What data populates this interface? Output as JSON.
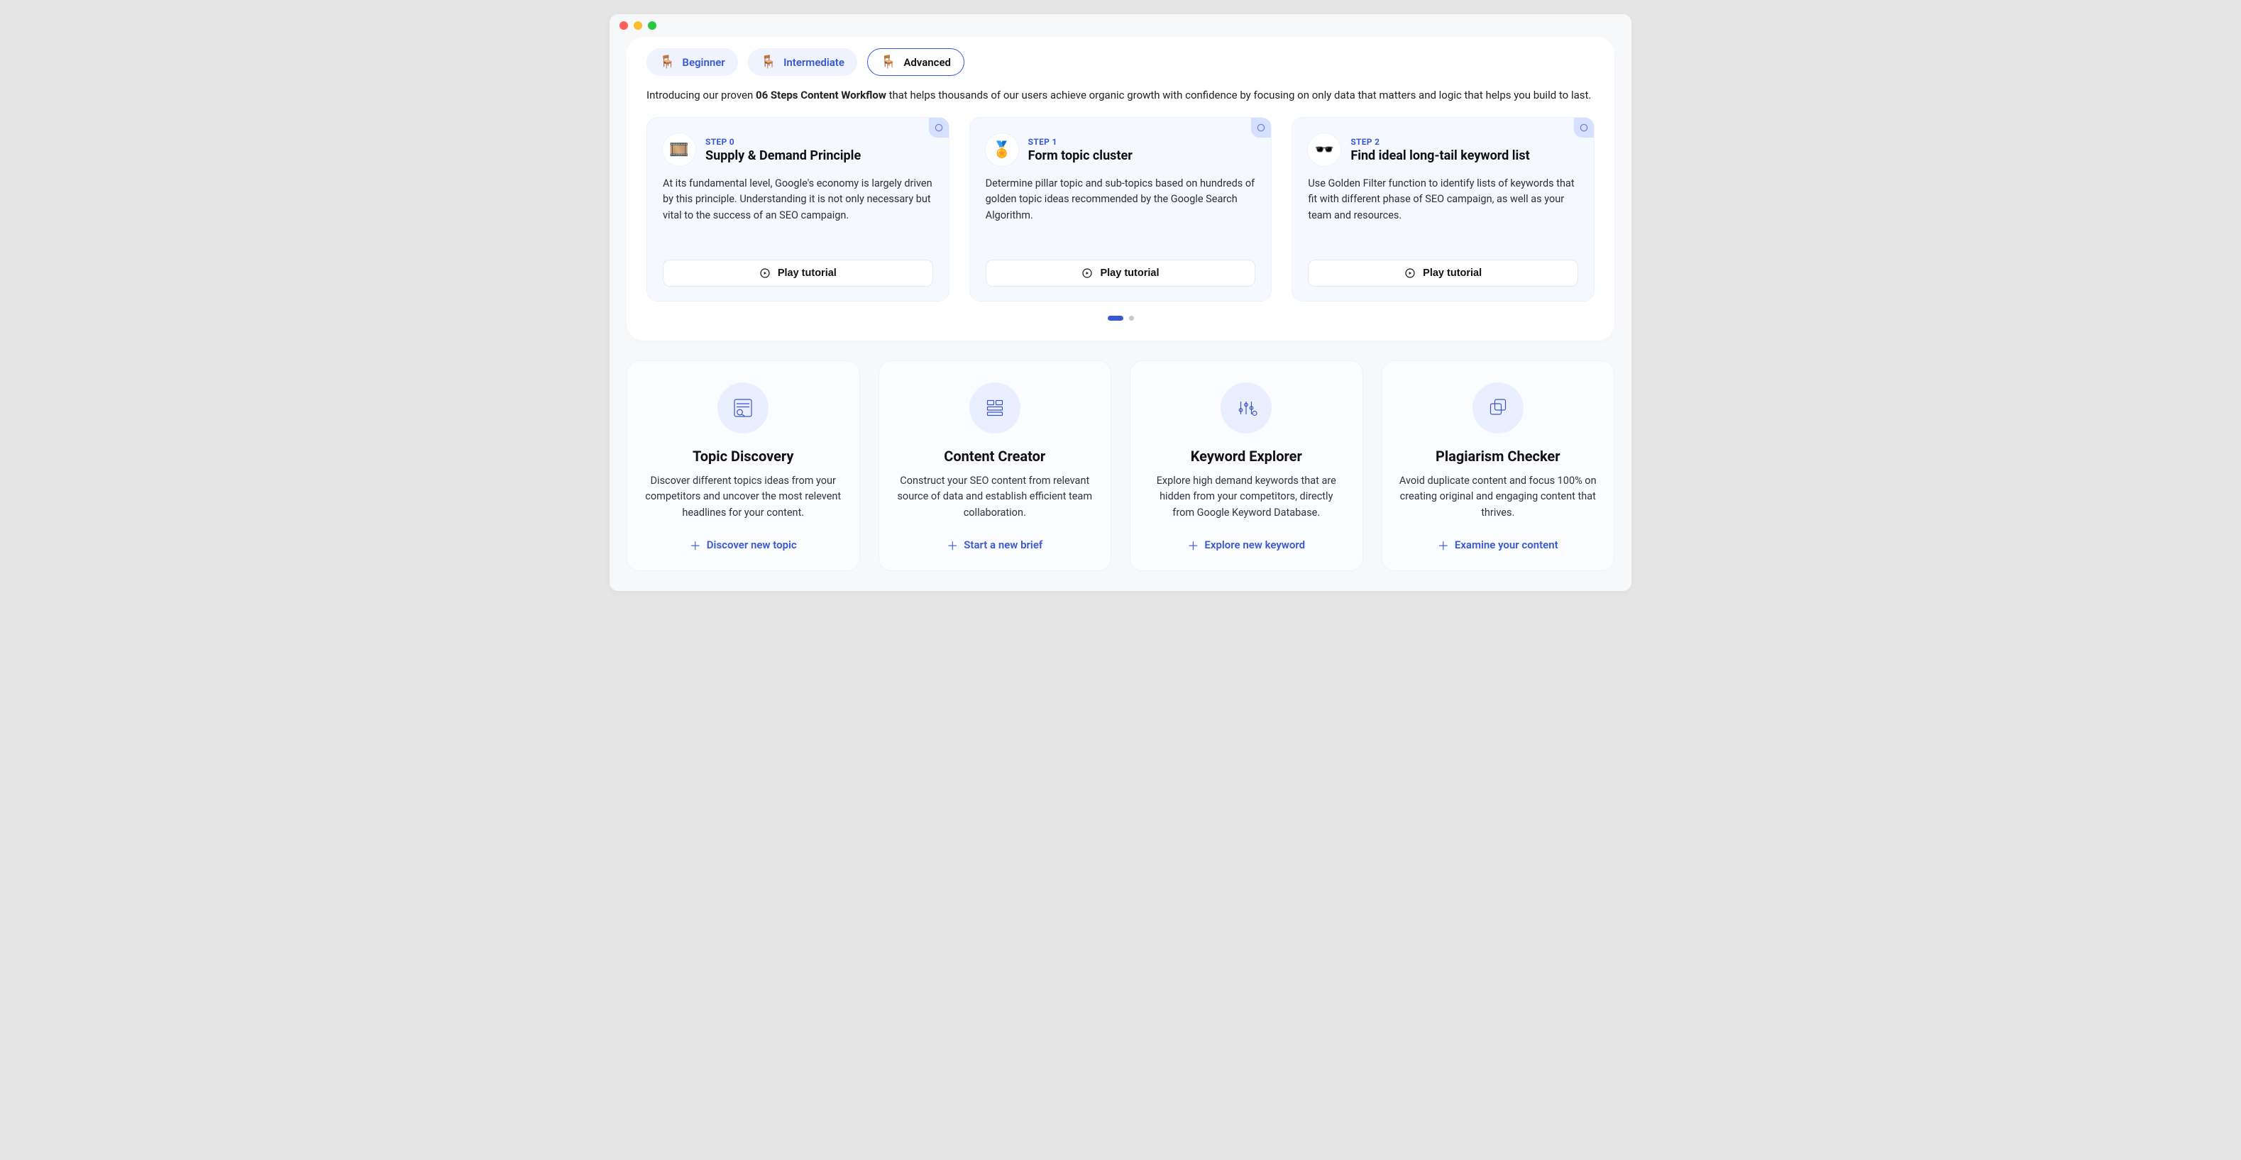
{
  "tabs": [
    {
      "label": "Beginner",
      "emoji": "🪑",
      "active": false
    },
    {
      "label": "Intermediate",
      "emoji": "🪑",
      "active": false
    },
    {
      "label": "Advanced",
      "emoji": "🪑",
      "active": true
    }
  ],
  "intro_prefix": "Introducing our proven ",
  "intro_bold": "06 Steps Content Workflow",
  "intro_suffix": " that helps thousands of our users achieve organic growth with confidence by focusing on only data that matters and logic that helps you build to last.",
  "steps": [
    {
      "step_label": "STEP 0",
      "title": "Supply & Demand Principle",
      "emoji": "🎞️",
      "body": "At its fundamental level, Google's economy is largely driven by this principle. Understanding it is not only necessary but vital to the success of an SEO campaign.",
      "cta": "Play tutorial"
    },
    {
      "step_label": "STEP 1",
      "title": "Form topic cluster",
      "emoji": "🏅",
      "body": "Determine pillar topic and sub-topics based on hundreds of golden topic ideas recommended by the Google Search Algorithm.",
      "cta": "Play tutorial"
    },
    {
      "step_label": "STEP 2",
      "title": "Find ideal long-tail keyword list",
      "emoji": "🕶️",
      "body": "Use Golden Filter function to identify lists of keywords that fit with different phase of SEO campaign, as well as your team and resources.",
      "cta": "Play tutorial"
    }
  ],
  "pager": {
    "pages": 2,
    "active": 0
  },
  "features": [
    {
      "title": "Topic Discovery",
      "desc": "Discover different topics ideas from your competitors and uncover the most relevent headlines for your content.",
      "action": "Discover new topic",
      "icon": "search-list"
    },
    {
      "title": "Content Creator",
      "desc": "Construct your SEO content from relevant source of data and establish efficient team collaboration.",
      "action": "Start a new brief",
      "icon": "form"
    },
    {
      "title": "Keyword Explorer",
      "desc": "Explore high demand keywords that are hidden from your competitors, directly from Google Keyword Database.",
      "action": "Explore new keyword",
      "icon": "sliders"
    },
    {
      "title": "Plagiarism Checker",
      "desc": "Avoid duplicate content and focus 100% on creating original and engaging content that thrives.",
      "action": "Examine your content",
      "icon": "copy"
    }
  ]
}
